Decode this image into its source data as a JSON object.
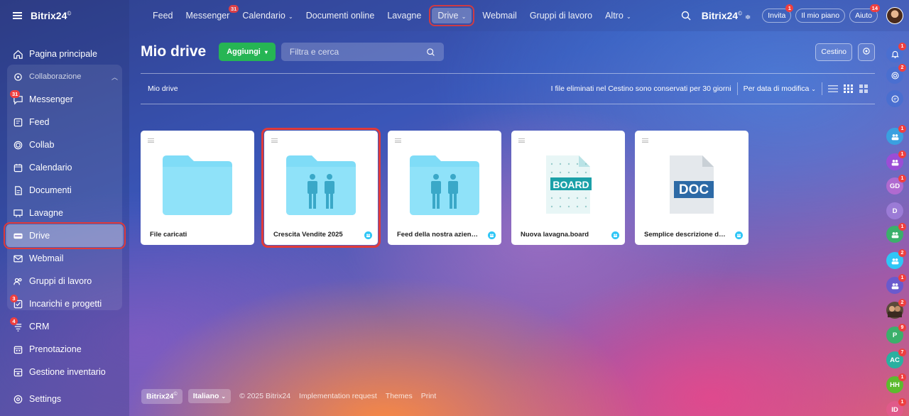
{
  "app": {
    "logo": "Bitrix24",
    "logo_mark": "©"
  },
  "sidebar": {
    "items": [
      {
        "label": "Pagina principale",
        "icon": "home-icon"
      },
      {
        "label": "Collaborazione",
        "icon": "collab-group-icon",
        "group": true
      },
      {
        "label": "Messenger",
        "icon": "messenger-icon",
        "badge": "31"
      },
      {
        "label": "Feed",
        "icon": "feed-icon"
      },
      {
        "label": "Collab",
        "icon": "collab-icon"
      },
      {
        "label": "Calendario",
        "icon": "calendar-icon"
      },
      {
        "label": "Documenti",
        "icon": "documents-icon"
      },
      {
        "label": "Lavagne",
        "icon": "whiteboard-icon"
      },
      {
        "label": "Drive",
        "icon": "drive-icon",
        "active": true
      },
      {
        "label": "Webmail",
        "icon": "mail-icon"
      },
      {
        "label": "Gruppi di lavoro",
        "icon": "workgroups-icon"
      },
      {
        "label": "Incarichi e progetti",
        "icon": "tasks-icon",
        "badge": "3"
      },
      {
        "label": "CRM",
        "icon": "crm-icon",
        "badge": "4"
      },
      {
        "label": "Prenotazione",
        "icon": "booking-icon"
      },
      {
        "label": "Gestione inventario",
        "icon": "inventory-icon"
      }
    ],
    "settings": "Settings"
  },
  "topnav": {
    "items": [
      {
        "label": "Feed"
      },
      {
        "label": "Messenger",
        "badge": "31"
      },
      {
        "label": "Calendario",
        "caret": true
      },
      {
        "label": "Documenti online"
      },
      {
        "label": "Lavagne"
      },
      {
        "label": "Drive",
        "caret": true,
        "active": true
      },
      {
        "label": "Webmail"
      },
      {
        "label": "Gruppi di lavoro"
      },
      {
        "label": "Altro",
        "caret": true
      }
    ],
    "brand": "Bitrix24",
    "invite": "Invita",
    "invite_badge": "1",
    "plan": "Il mio piano",
    "help": "Aiuto",
    "help_badge": "14"
  },
  "page": {
    "title": "Mio drive",
    "add_button": "Aggiungi",
    "search_placeholder": "Filtra e cerca",
    "trash_button": "Cestino",
    "breadcrumb": "Mio drive",
    "trash_notice": "I file eliminati nel Cestino sono conservati per 30 giorni",
    "sort_label": "Per data di modifica"
  },
  "files": [
    {
      "name": "File caricati",
      "type": "folder"
    },
    {
      "name": "Crescita Vendite 2025",
      "type": "shared-folder"
    },
    {
      "name": "Feed della nostra azienda_",
      "type": "shared-folder"
    },
    {
      "name": "Nuova lavagna.board",
      "type": "board",
      "label": "BOARD"
    },
    {
      "name": "Semplice descrizione del pro...",
      "type": "doc",
      "label": "DOC"
    }
  ],
  "right_bar": [
    {
      "kind": "bell-icon",
      "badge": "1",
      "color": "#4a6fd0"
    },
    {
      "kind": "copilot-icon",
      "badge": "2",
      "color": "#4a6fd0"
    },
    {
      "kind": "search-chat-icon",
      "color": "#4a6fd0"
    },
    {
      "kind": "group-chat-icon",
      "badge": "1",
      "color": "#3aa0e0"
    },
    {
      "kind": "channel-icon",
      "badge": "1",
      "color": "#9b4dd6"
    },
    {
      "initials": "GD",
      "badge": "1",
      "color": "#b06ad0"
    },
    {
      "initials": "D",
      "color": "#9b7bd6"
    },
    {
      "kind": "group-chat-icon",
      "badge": "1",
      "color": "#3bb06b"
    },
    {
      "kind": "chat-icon",
      "badge": "2",
      "color": "#2fc6f6"
    },
    {
      "kind": "group-chat-icon",
      "badge": "1",
      "color": "#6a5acd"
    },
    {
      "kind": "photo-avatar",
      "badge": "2",
      "color": "#5a4a3a"
    },
    {
      "initials": "P",
      "badge": "9",
      "color": "#3bb06b"
    },
    {
      "initials": "AC",
      "badge": "7",
      "color": "#2ab0a0"
    },
    {
      "initials": "HH",
      "badge": "1",
      "color": "#5dbb2e"
    },
    {
      "initials": "ID",
      "badge": "1",
      "color": "#e05a8a"
    }
  ],
  "footer": {
    "brand": "Bitrix24",
    "language": "Italiano",
    "copyright": "© 2025 Bitrix24",
    "links": [
      "Implementation request",
      "Themes",
      "Print"
    ]
  }
}
